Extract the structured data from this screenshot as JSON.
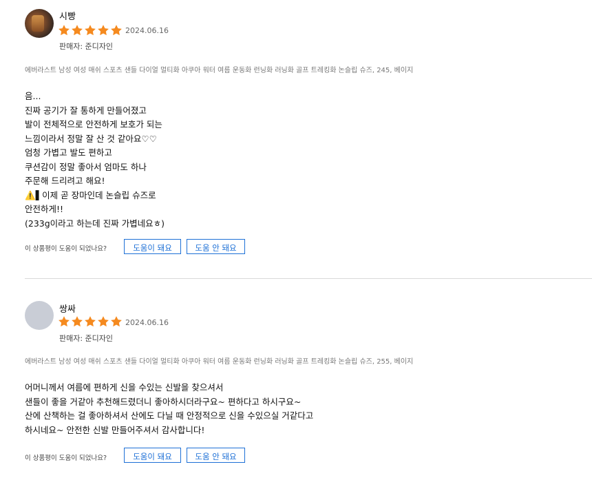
{
  "colors": {
    "star": "#f58a1f",
    "button": "#1c6fd6",
    "divider": "#d9d9d9"
  },
  "reviews": [
    {
      "nickname": "시빵",
      "rating": 5,
      "date": "2024.06.16",
      "seller": "판매자: 준디자인",
      "option": "에버라스트 남성 여성 매쉬 스포츠 샌들 다이얼 멀티화 아쿠아 워터 여름 운동화 런닝화 러닝화 골프 트레킹화 논슬립 슈즈, 245, 베이지",
      "lines": [
        "음...",
        "진짜 공기가 잘 통하게 만들어졌고",
        "발이 전체적으로 안전하게 보호가 되는",
        "느낌이라서 정말 잘 산 것 같아요♡♡",
        "엄청 가볍고 발도 편하고",
        "쿠션감이 정말 좋아서 엄마도 하나",
        "주문해 드리려고 해요!",
        "⚠️▌이제 곧 장마인데 논슬립 슈즈로",
        "안전하게!!",
        "(233g이라고 하는데 진짜 가볍네요ㅎ)"
      ],
      "helpful_question": "이 상품평이 도움이 되었나요?",
      "helpful_yes": "도움이 돼요",
      "helpful_no": "도움 안 돼요"
    },
    {
      "nickname": "쌍싸",
      "rating": 5,
      "date": "2024.06.16",
      "seller": "판매자: 준디자인",
      "option": "에버라스트 남성 여성 매쉬 스포츠 샌들 다이얼 멀티화 아쿠아 워터 여름 운동화 런닝화 러닝화 골프 트레킹화 논슬립 슈즈, 255, 베이지",
      "lines": [
        "어머니께서 여름에 편하게 신을 수있는 신발을 찾으셔서",
        "샌들이 좋을 거같아 추천해드렸더니 좋아하시더라구요~ 편하다고 하시구요~",
        "산에 산책하는 걸 좋아하셔서 산에도 다닐 때 안정적으로 신을 수있으실 거같다고",
        "하시네요~ 안전한 신발 만들어주셔서 감사합니다!"
      ],
      "helpful_question": "이 상품평이 도움이 되었나요?",
      "helpful_yes": "도움이 돼요",
      "helpful_no": "도움 안 돼요"
    }
  ]
}
